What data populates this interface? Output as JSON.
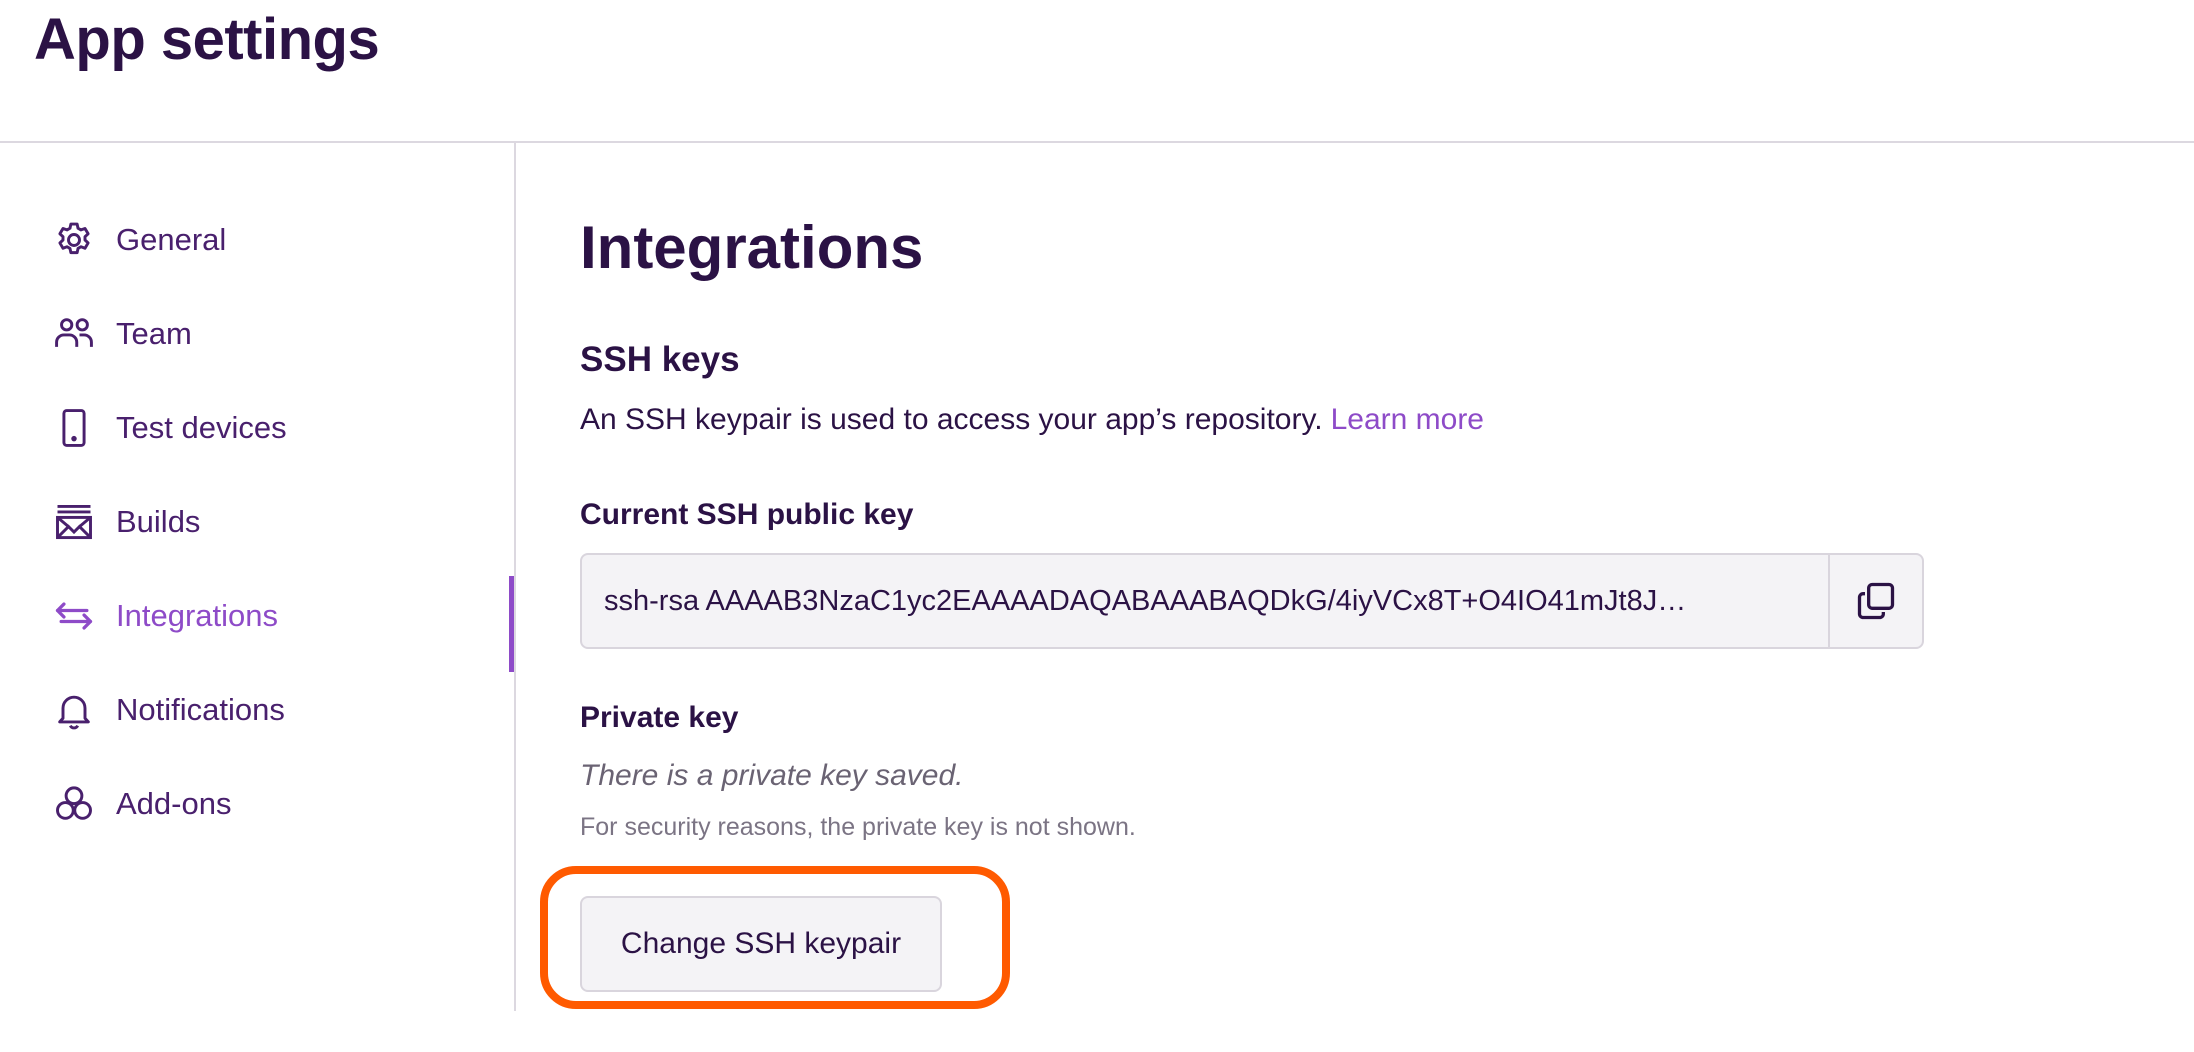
{
  "header": {
    "title": "App settings"
  },
  "sidebar": {
    "items": [
      {
        "label": "General",
        "icon": "gear-icon",
        "active": false
      },
      {
        "label": "Team",
        "icon": "team-icon",
        "active": false
      },
      {
        "label": "Test devices",
        "icon": "phone-icon",
        "active": false
      },
      {
        "label": "Builds",
        "icon": "builds-icon",
        "active": false
      },
      {
        "label": "Integrations",
        "icon": "integrations-icon",
        "active": true
      },
      {
        "label": "Notifications",
        "icon": "bell-icon",
        "active": false
      },
      {
        "label": "Add-ons",
        "icon": "addons-icon",
        "active": false
      }
    ]
  },
  "main": {
    "title": "Integrations",
    "ssh": {
      "title": "SSH keys",
      "description": "An SSH keypair is used to access your app’s repository.",
      "learn_more": "Learn more",
      "public_key_label": "Current SSH public key",
      "public_key_value": "ssh-rsa AAAAB3NzaC1yc2EAAAADAQABAAABAQDkG/4iyVCx8T+O4IO41mJt8J…",
      "private_key_label": "Private key",
      "private_key_status": "There is a private key saved.",
      "private_key_note": "For security reasons, the private key is not shown.",
      "change_button_label": "Change SSH keypair"
    }
  },
  "colors": {
    "text": "#2b1245",
    "accent": "#8e4bc8",
    "highlight": "#ff5a00"
  }
}
